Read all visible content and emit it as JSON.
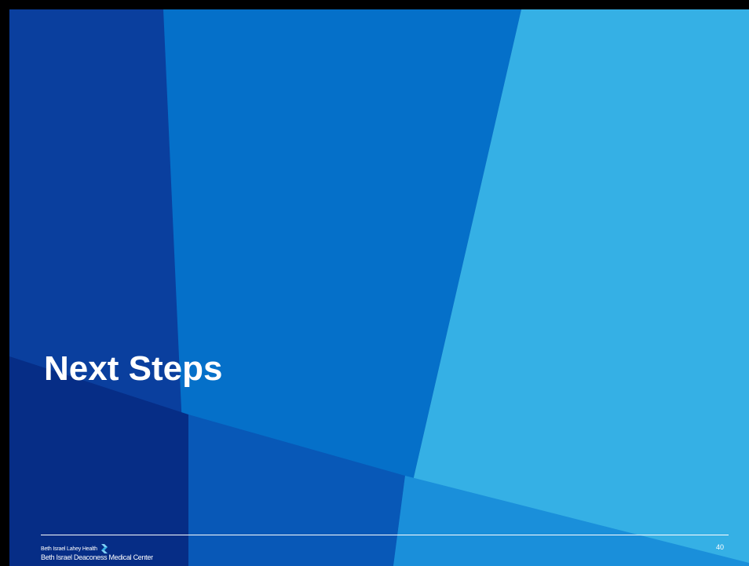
{
  "slide": {
    "title": "Next Steps",
    "number": "40"
  },
  "logo": {
    "parent_name": "Beth Israel Lahey Health",
    "center_name": "Beth Israel Deaconess Medical Center",
    "mark_icon": "bilh-arrow-logo-icon"
  },
  "colors": {
    "navy": "#0a3f9e",
    "mid_blue": "#0570c9",
    "light_blue": "#35b0e5",
    "dark_navy": "#062d86",
    "overlap_blue": "#0858b7",
    "text": "#ffffff"
  }
}
